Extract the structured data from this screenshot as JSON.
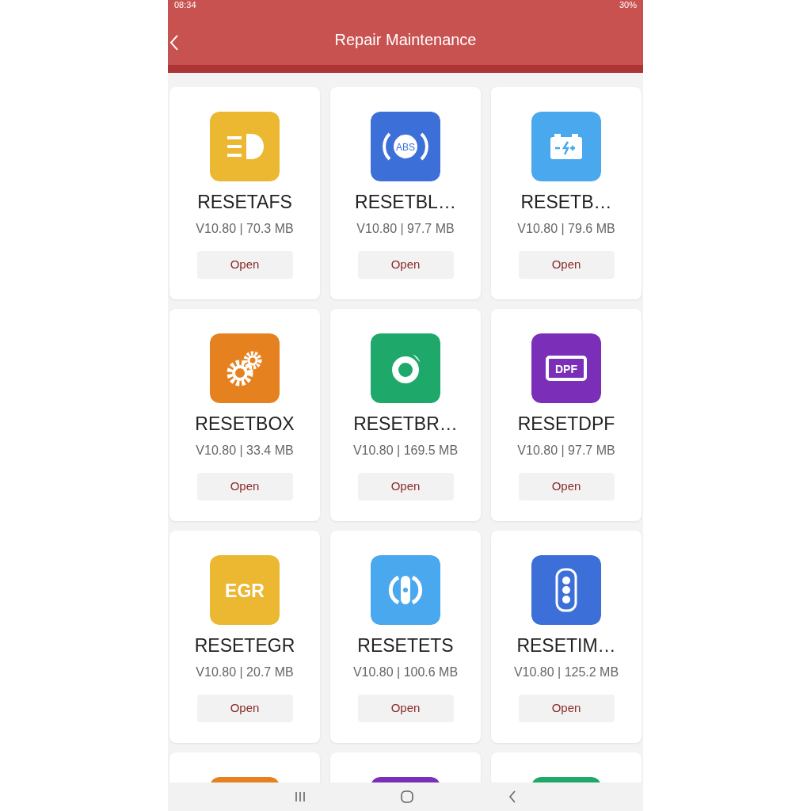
{
  "status_bar": {
    "time": "08:34",
    "battery": "30%"
  },
  "header": {
    "title": "Repair Maintenance"
  },
  "apps": [
    {
      "name": "RESETAFS",
      "info": "V10.80 | 70.3 MB",
      "button": "Open",
      "kind": "headlight",
      "color": "#ecb731"
    },
    {
      "name": "RESETBL…",
      "info": "V10.80 | 97.7 MB",
      "button": "Open",
      "kind": "abs",
      "color": "#3d6fd8",
      "icon_text": "ABS"
    },
    {
      "name": "RESETB…",
      "info": "V10.80 | 79.6 MB",
      "button": "Open",
      "kind": "battery",
      "color": "#4aa8ee"
    },
    {
      "name": "RESETBOX",
      "info": "V10.80 | 33.4 MB",
      "button": "Open",
      "kind": "gears",
      "color": "#e5821f"
    },
    {
      "name": "RESETBR…",
      "info": "V10.80 | 169.5 MB",
      "button": "Open",
      "kind": "brake",
      "color": "#1ea86a"
    },
    {
      "name": "RESETDPF",
      "info": "V10.80 | 97.7 MB",
      "button": "Open",
      "kind": "dpf",
      "color": "#7b2fb8",
      "icon_text": "DPF"
    },
    {
      "name": "RESETEGR",
      "info": "V10.80 | 20.7 MB",
      "button": "Open",
      "kind": "egr",
      "color": "#ecb731",
      "icon_text": "EGR"
    },
    {
      "name": "RESETETS",
      "info": "V10.80 | 100.6 MB",
      "button": "Open",
      "kind": "ets",
      "color": "#4aa8ee"
    },
    {
      "name": "RESETIM…",
      "info": "V10.80 | 125.2 MB",
      "button": "Open",
      "kind": "keyfob",
      "color": "#3d6fd8"
    },
    {
      "kind": "partial",
      "color": "#e5821f"
    },
    {
      "kind": "partial",
      "color": "#7b2fb8"
    },
    {
      "kind": "partial",
      "color": "#1ea86a"
    }
  ]
}
